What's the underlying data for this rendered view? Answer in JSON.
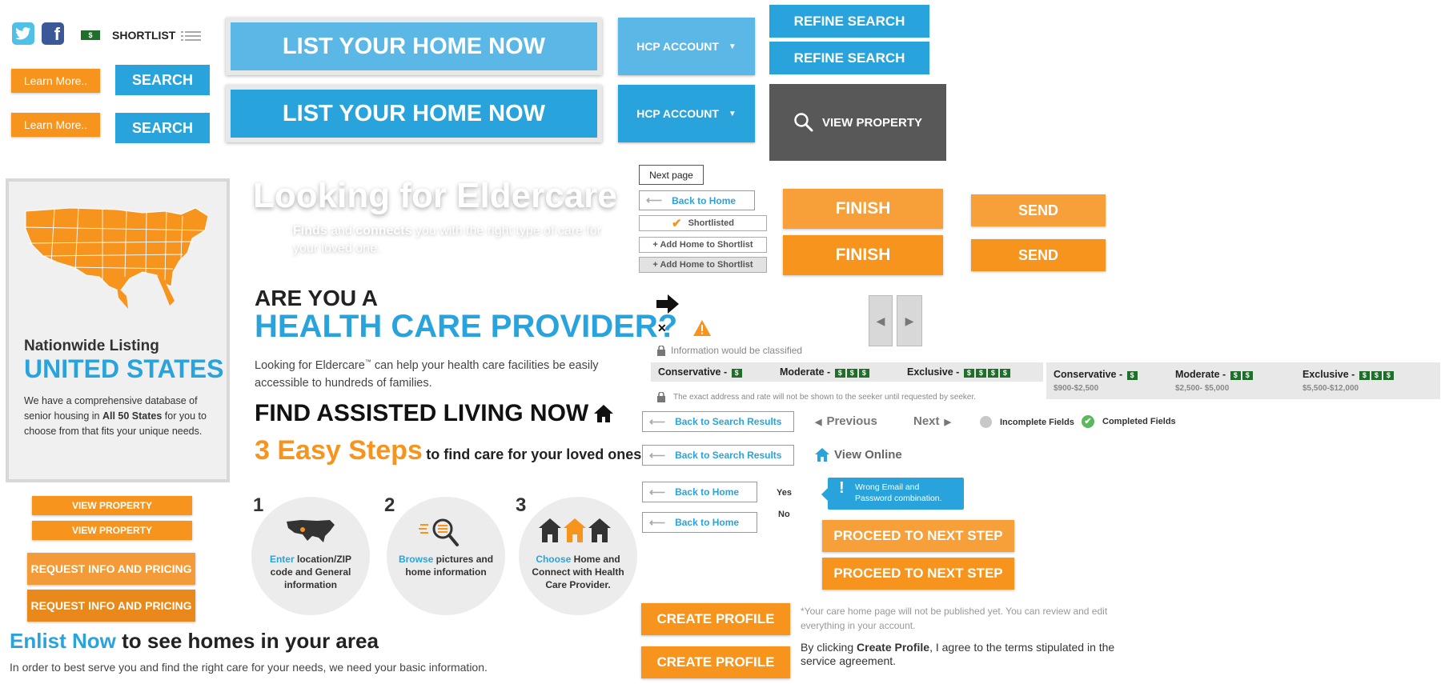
{
  "colors": {
    "blue": "#29a3dc",
    "orange": "#f7941d",
    "dark": "#555555",
    "green": "#1f6e2a"
  },
  "topbar": {
    "shortlist_label": "SHORTLIST",
    "money_label": "$"
  },
  "buttons": {
    "learn_more": "Learn More..",
    "search": "SEARCH",
    "list_home": "LIST YOUR HOME NOW",
    "hcp_account": "HCP ACCOUNT",
    "refine_search": "REFINE SEARCH",
    "view_property_dark": "VIEW PROPERTY",
    "next_page": "Next page",
    "back_home": "Back to Home",
    "shortlisted": "Shortlisted",
    "add_shortlist": "+ Add Home to Shortlist",
    "finish": "FINISH",
    "send": "SEND",
    "view_property": "VIEW PROPERTY",
    "request_info": "REQUEST INFO AND PRICING",
    "back_search": "Back to Search Results",
    "proceed": "PROCEED TO NEXT STEP",
    "create_profile": "CREATE PROFILE"
  },
  "hero": {
    "title": "Looking for Eldercare",
    "subtitle_finds": "Finds",
    "subtitle_and": "and",
    "subtitle_connects": "connects",
    "subtitle_rest": "you with the right type of care for your loved one."
  },
  "map_card": {
    "label": "Nationwide Listing",
    "country": "UNITED STATES",
    "desc_1": "We have a comprehensive database of senior housing in ",
    "desc_bold": "All 50 States",
    "desc_2": " for you to choose from that fits your unique needs."
  },
  "provider": {
    "question": "ARE YOU A",
    "headline": "HEALTH CARE PROVIDER?",
    "desc_1": "Looking for Eldercare",
    "tm": "™",
    "desc_2": " can help your health care facilities be easily accessible to hundreds of families."
  },
  "assisted": {
    "title": "FIND ASSISTED LIVING NOW"
  },
  "steps_heading": {
    "big": "3 Easy Steps",
    "small": "to find care for your loved ones"
  },
  "steps": [
    {
      "num": "1",
      "hl": "Enter",
      "text": "location/ZIP code and General information"
    },
    {
      "num": "2",
      "hl": "Browse",
      "text": "pictures and home information"
    },
    {
      "num": "3",
      "hl": "Choose",
      "text": "Home and Connect with Health Care Provider."
    }
  ],
  "enlist": {
    "hl": "Enlist Now",
    "rest": "to see homes in your area",
    "desc": "In order to best serve you and find the right care for your needs, we need your basic information."
  },
  "classified": {
    "info": "Information would be classified",
    "address_note": "The exact address and rate will not be shown to the seeker until requested by seeker."
  },
  "tiers": [
    {
      "name": "Conservative -",
      "count": 1,
      "range": "$900-$2,500"
    },
    {
      "name": "Moderate -",
      "count": 2,
      "range": "$2,500- $5,000"
    },
    {
      "name": "Exclusive -",
      "count": 3,
      "range": "$5,500-$12,000"
    }
  ],
  "pagination": {
    "previous": "Previous",
    "next": "Next"
  },
  "fields": {
    "incomplete": "Incomplete Fields",
    "completed": "Completed Fields"
  },
  "view_online": "View Online",
  "yes": "Yes",
  "no": "No",
  "error_tooltip": "Wrong Email and Password combination.",
  "profile_note": "*Your care home page will not be published yet. You can review and edit everything in your account.",
  "terms": {
    "pre": "By clicking ",
    "bold": "Create Profile",
    "post": ", I agree to the terms stipulated in the service agreement."
  }
}
